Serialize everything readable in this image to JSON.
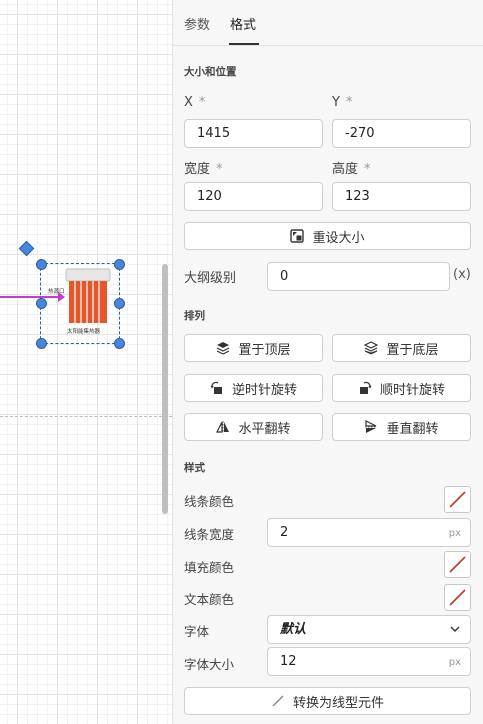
{
  "canvas": {
    "shape": {
      "top_label": "热源口",
      "bottom_label": "太阳能集热器"
    }
  },
  "tabs": [
    {
      "label": "参数",
      "active": false
    },
    {
      "label": "格式",
      "active": true
    }
  ],
  "size_position": {
    "title": "大小和位置",
    "x_label": "X",
    "y_label": "Y",
    "required_mark": "*",
    "x_value": "1415",
    "y_value": "-270",
    "width_label": "宽度",
    "height_label": "高度",
    "width_value": "120",
    "height_value": "123",
    "reset_size_label": "重设大小",
    "outline_level_label": "大纲级别",
    "outline_level_value": "0",
    "outline_level_suffix": "(x)"
  },
  "arrange": {
    "title": "排列",
    "to_front": "置于顶层",
    "to_back": "置于底层",
    "rotate_ccw": "逆时针旋转",
    "rotate_cw": "顺时针旋转",
    "flip_h": "水平翻转",
    "flip_v": "垂直翻转"
  },
  "style": {
    "title": "样式",
    "line_color_label": "线条颜色",
    "line_width_label": "线条宽度",
    "line_width_value": "2",
    "line_width_unit": "px",
    "fill_color_label": "填充颜色",
    "text_color_label": "文本颜色",
    "font_label": "字体",
    "font_value": "默认",
    "font_size_label": "字体大小",
    "font_size_value": "12",
    "font_size_unit": "px",
    "convert_label": "转换为线型元件"
  },
  "colors": {
    "accent": "#4a86d6",
    "connector": "#c83cc8",
    "heater": "#e2572b",
    "no_color_slash": "#c0392b"
  }
}
